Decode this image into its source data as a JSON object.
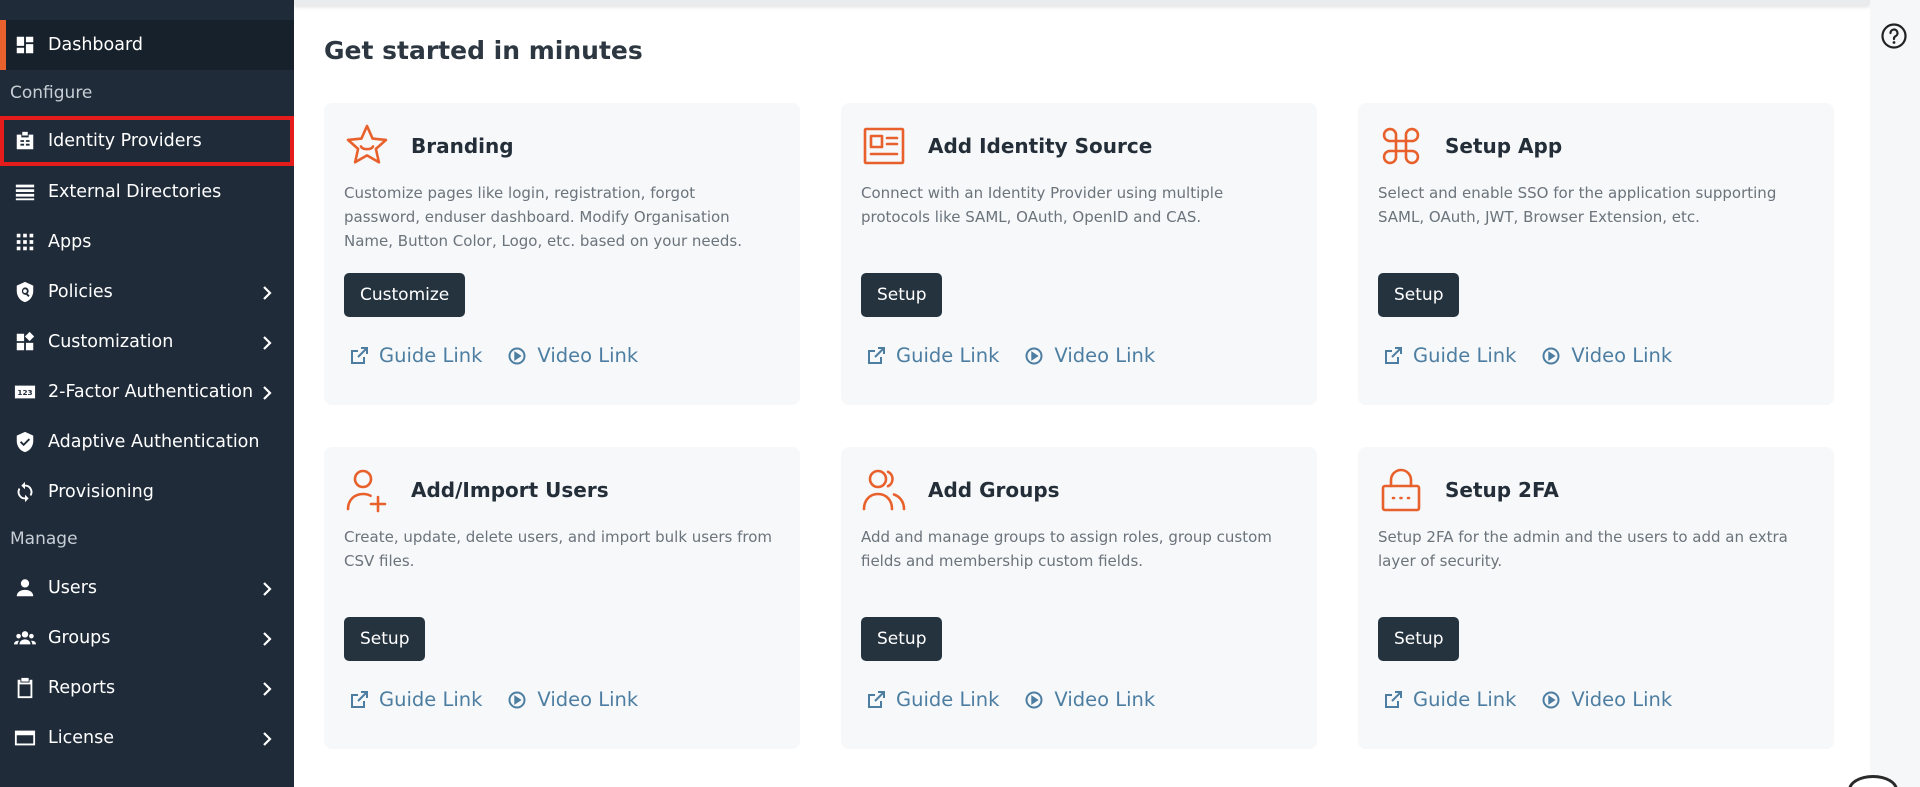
{
  "sidebar": {
    "items": [
      {
        "label": "Dashboard",
        "icon": "dashboard-icon"
      },
      {
        "label": "Identity Providers",
        "icon": "id-card-icon"
      },
      {
        "label": "External Directories",
        "icon": "list-icon"
      },
      {
        "label": "Apps",
        "icon": "grid-icon"
      },
      {
        "label": "Policies",
        "icon": "shield-lock-icon"
      },
      {
        "label": "Customization",
        "icon": "widgets-icon"
      },
      {
        "label": "2-Factor Authentication",
        "icon": "numbers-123-icon"
      },
      {
        "label": "Adaptive Authentication",
        "icon": "shield-check-icon"
      },
      {
        "label": "Provisioning",
        "icon": "sync-icon"
      },
      {
        "label": "Users",
        "icon": "user-icon"
      },
      {
        "label": "Groups",
        "icon": "group-icon"
      },
      {
        "label": "Reports",
        "icon": "clipboard-icon"
      },
      {
        "label": "License",
        "icon": "card-icon"
      }
    ],
    "sections": {
      "configure": "Configure",
      "manage": "Manage"
    }
  },
  "main": {
    "title": "Get started in minutes",
    "cards": [
      {
        "title": "Branding",
        "icon": "star-face-icon",
        "description": "Customize pages like login, registration, forgot password, enduser dashboard. Modify Organisation Name, Button Color, Logo, etc. based on your needs.",
        "button": "Customize",
        "guide": "Guide Link",
        "video": "Video Link"
      },
      {
        "title": "Add Identity Source",
        "icon": "id-badge-icon",
        "description": "Connect with an Identity Provider using multiple protocols like SAML, OAuth, OpenID and CAS.",
        "button": "Setup",
        "guide": "Guide Link",
        "video": "Video Link"
      },
      {
        "title": "Setup App",
        "icon": "command-icon",
        "description": "Select and enable SSO for the application supporting SAML, OAuth, JWT, Browser Extension, etc.",
        "button": "Setup",
        "guide": "Guide Link",
        "video": "Video Link"
      },
      {
        "title": "Add/Import Users",
        "icon": "user-add-icon",
        "description": "Create, update, delete users, and import bulk users from CSV files.",
        "button": "Setup",
        "guide": "Guide Link",
        "video": "Video Link"
      },
      {
        "title": "Add Groups",
        "icon": "users-icon",
        "description": "Add and manage groups to assign roles, group custom fields and membership custom fields.",
        "button": "Setup",
        "guide": "Guide Link",
        "video": "Video Link"
      },
      {
        "title": "Setup 2FA",
        "icon": "lock-icon",
        "description": "Setup 2FA for the admin and the users to add an extra layer of security.",
        "button": "Setup",
        "guide": "Guide Link",
        "video": "Video Link"
      }
    ]
  },
  "help_icon": "help-circle-icon",
  "colors": {
    "sidebar": "#1f2b38",
    "accent": "#e8612c",
    "highlight": "#e51c1c",
    "button": "#25333f",
    "link": "#4d7ea1",
    "card": "#f6f8fa"
  }
}
